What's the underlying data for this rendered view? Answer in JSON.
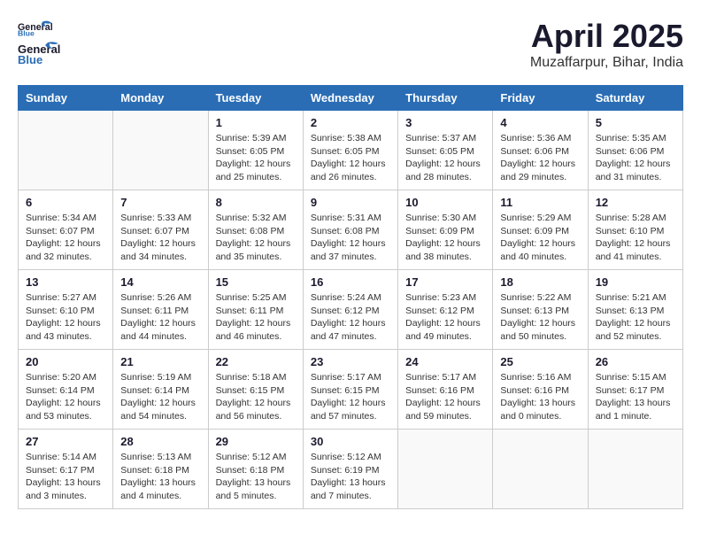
{
  "header": {
    "logo_line1": "General",
    "logo_line2": "Blue",
    "month": "April 2025",
    "location": "Muzaffarpur, Bihar, India"
  },
  "weekdays": [
    "Sunday",
    "Monday",
    "Tuesday",
    "Wednesday",
    "Thursday",
    "Friday",
    "Saturday"
  ],
  "weeks": [
    [
      {
        "day": "",
        "info": ""
      },
      {
        "day": "",
        "info": ""
      },
      {
        "day": "1",
        "info": "Sunrise: 5:39 AM\nSunset: 6:05 PM\nDaylight: 12 hours\nand 25 minutes."
      },
      {
        "day": "2",
        "info": "Sunrise: 5:38 AM\nSunset: 6:05 PM\nDaylight: 12 hours\nand 26 minutes."
      },
      {
        "day": "3",
        "info": "Sunrise: 5:37 AM\nSunset: 6:05 PM\nDaylight: 12 hours\nand 28 minutes."
      },
      {
        "day": "4",
        "info": "Sunrise: 5:36 AM\nSunset: 6:06 PM\nDaylight: 12 hours\nand 29 minutes."
      },
      {
        "day": "5",
        "info": "Sunrise: 5:35 AM\nSunset: 6:06 PM\nDaylight: 12 hours\nand 31 minutes."
      }
    ],
    [
      {
        "day": "6",
        "info": "Sunrise: 5:34 AM\nSunset: 6:07 PM\nDaylight: 12 hours\nand 32 minutes."
      },
      {
        "day": "7",
        "info": "Sunrise: 5:33 AM\nSunset: 6:07 PM\nDaylight: 12 hours\nand 34 minutes."
      },
      {
        "day": "8",
        "info": "Sunrise: 5:32 AM\nSunset: 6:08 PM\nDaylight: 12 hours\nand 35 minutes."
      },
      {
        "day": "9",
        "info": "Sunrise: 5:31 AM\nSunset: 6:08 PM\nDaylight: 12 hours\nand 37 minutes."
      },
      {
        "day": "10",
        "info": "Sunrise: 5:30 AM\nSunset: 6:09 PM\nDaylight: 12 hours\nand 38 minutes."
      },
      {
        "day": "11",
        "info": "Sunrise: 5:29 AM\nSunset: 6:09 PM\nDaylight: 12 hours\nand 40 minutes."
      },
      {
        "day": "12",
        "info": "Sunrise: 5:28 AM\nSunset: 6:10 PM\nDaylight: 12 hours\nand 41 minutes."
      }
    ],
    [
      {
        "day": "13",
        "info": "Sunrise: 5:27 AM\nSunset: 6:10 PM\nDaylight: 12 hours\nand 43 minutes."
      },
      {
        "day": "14",
        "info": "Sunrise: 5:26 AM\nSunset: 6:11 PM\nDaylight: 12 hours\nand 44 minutes."
      },
      {
        "day": "15",
        "info": "Sunrise: 5:25 AM\nSunset: 6:11 PM\nDaylight: 12 hours\nand 46 minutes."
      },
      {
        "day": "16",
        "info": "Sunrise: 5:24 AM\nSunset: 6:12 PM\nDaylight: 12 hours\nand 47 minutes."
      },
      {
        "day": "17",
        "info": "Sunrise: 5:23 AM\nSunset: 6:12 PM\nDaylight: 12 hours\nand 49 minutes."
      },
      {
        "day": "18",
        "info": "Sunrise: 5:22 AM\nSunset: 6:13 PM\nDaylight: 12 hours\nand 50 minutes."
      },
      {
        "day": "19",
        "info": "Sunrise: 5:21 AM\nSunset: 6:13 PM\nDaylight: 12 hours\nand 52 minutes."
      }
    ],
    [
      {
        "day": "20",
        "info": "Sunrise: 5:20 AM\nSunset: 6:14 PM\nDaylight: 12 hours\nand 53 minutes."
      },
      {
        "day": "21",
        "info": "Sunrise: 5:19 AM\nSunset: 6:14 PM\nDaylight: 12 hours\nand 54 minutes."
      },
      {
        "day": "22",
        "info": "Sunrise: 5:18 AM\nSunset: 6:15 PM\nDaylight: 12 hours\nand 56 minutes."
      },
      {
        "day": "23",
        "info": "Sunrise: 5:17 AM\nSunset: 6:15 PM\nDaylight: 12 hours\nand 57 minutes."
      },
      {
        "day": "24",
        "info": "Sunrise: 5:17 AM\nSunset: 6:16 PM\nDaylight: 12 hours\nand 59 minutes."
      },
      {
        "day": "25",
        "info": "Sunrise: 5:16 AM\nSunset: 6:16 PM\nDaylight: 13 hours\nand 0 minutes."
      },
      {
        "day": "26",
        "info": "Sunrise: 5:15 AM\nSunset: 6:17 PM\nDaylight: 13 hours\nand 1 minute."
      }
    ],
    [
      {
        "day": "27",
        "info": "Sunrise: 5:14 AM\nSunset: 6:17 PM\nDaylight: 13 hours\nand 3 minutes."
      },
      {
        "day": "28",
        "info": "Sunrise: 5:13 AM\nSunset: 6:18 PM\nDaylight: 13 hours\nand 4 minutes."
      },
      {
        "day": "29",
        "info": "Sunrise: 5:12 AM\nSunset: 6:18 PM\nDaylight: 13 hours\nand 5 minutes."
      },
      {
        "day": "30",
        "info": "Sunrise: 5:12 AM\nSunset: 6:19 PM\nDaylight: 13 hours\nand 7 minutes."
      },
      {
        "day": "",
        "info": ""
      },
      {
        "day": "",
        "info": ""
      },
      {
        "day": "",
        "info": ""
      }
    ]
  ]
}
